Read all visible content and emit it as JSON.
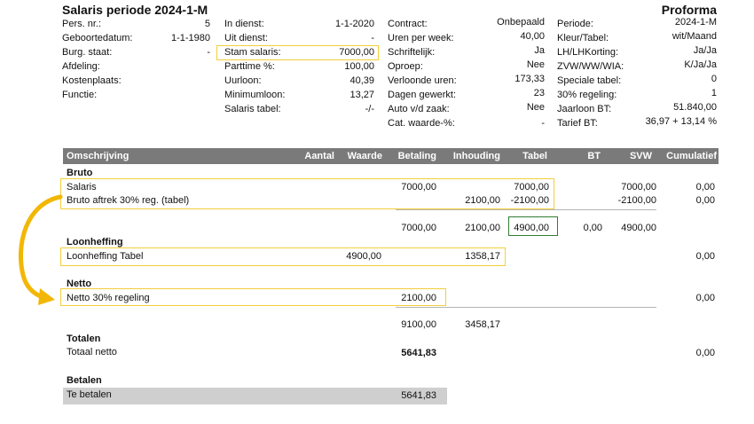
{
  "title": "Salaris periode 2024-1-M",
  "proforma": "Proforma",
  "info": {
    "col1": [
      {
        "label": "Pers. nr.:",
        "value": "5"
      },
      {
        "label": "Geboortedatum:",
        "value": "1-1-1980"
      },
      {
        "label": "Burg. staat:",
        "value": "-"
      },
      {
        "label": "Afdeling:",
        "value": ""
      },
      {
        "label": "Kostenplaats:",
        "value": ""
      },
      {
        "label": "Functie:",
        "value": ""
      }
    ],
    "col2": [
      {
        "label": "In dienst:",
        "value": "1-1-2020"
      },
      {
        "label": "Uit dienst:",
        "value": "-"
      },
      {
        "label": "Stam salaris:",
        "value": "7000,00"
      },
      {
        "label": "Parttime %:",
        "value": "100,00"
      },
      {
        "label": "Uurloon:",
        "value": "40,39"
      },
      {
        "label": "Minimumloon:",
        "value": "13,27"
      },
      {
        "label": "Salaris tabel:",
        "value": "-/-"
      }
    ],
    "col3": [
      {
        "label": "Contract:",
        "value": "Onbepaald"
      },
      {
        "label": "Uren per week:",
        "value": "40,00"
      },
      {
        "label": "Schriftelijk:",
        "value": "Ja"
      },
      {
        "label": "Oproep:",
        "value": "Nee"
      },
      {
        "label": "Verloonde uren:",
        "value": "173,33"
      },
      {
        "label": "Dagen gewerkt:",
        "value": "23"
      },
      {
        "label": "Auto v/d zaak:",
        "value": "Nee"
      },
      {
        "label": "Cat. waarde-%:",
        "value": "-"
      }
    ],
    "col4": [
      {
        "label": "Periode:",
        "value": "2024-1-M"
      },
      {
        "label": "Kleur/Tabel:",
        "value": "wit/Maand"
      },
      {
        "label": "LH/LHKorting:",
        "value": "Ja/Ja"
      },
      {
        "label": "ZVW/WW/WIA:",
        "value": "K/Ja/Ja"
      },
      {
        "label": "Speciale tabel:",
        "value": "0"
      },
      {
        "label": "30% regeling:",
        "value": "1"
      },
      {
        "label": "Jaarloon BT:",
        "value": "51.840,00"
      },
      {
        "label": "Tarief BT:",
        "value": "36,97 + 13,14 %"
      }
    ]
  },
  "table": {
    "headers": {
      "omschrijving": "Omschrijving",
      "aantal": "Aantal",
      "waarde": "Waarde",
      "betaling": "Betaling",
      "inhouding": "Inhouding",
      "tabel": "Tabel",
      "bt": "BT",
      "svw": "SVW",
      "cumulatief": "Cumulatief"
    },
    "bruto": {
      "heading": "Bruto",
      "row1": {
        "label": "Salaris",
        "betaling": "7000,00",
        "tabel": "7000,00",
        "svw": "7000,00",
        "cumulatief": "0,00"
      },
      "row2": {
        "label": "Bruto aftrek 30% reg. (tabel)",
        "inhouding": "2100,00",
        "tabel": "-2100,00",
        "svw": "-2100,00",
        "cumulatief": "0,00"
      },
      "subtotal": {
        "betaling": "7000,00",
        "inhouding": "2100,00",
        "tabel": "4900,00",
        "bt": "0,00",
        "svw": "4900,00"
      }
    },
    "loonheffing": {
      "heading": "Loonheffing",
      "row": {
        "label": "Loonheffing Tabel",
        "waarde": "4900,00",
        "inhouding": "1358,17",
        "cumulatief": "0,00"
      }
    },
    "netto": {
      "heading": "Netto",
      "row": {
        "label": "Netto 30% regeling",
        "betaling": "2100,00",
        "cumulatief": "0,00"
      },
      "subtotal": {
        "betaling": "9100,00",
        "inhouding": "3458,17"
      }
    },
    "totalen": {
      "heading": "Totalen",
      "row": {
        "label": "Totaal netto",
        "betaling": "5641,83",
        "cumulatief": "0,00"
      }
    },
    "betalen": {
      "heading": "Betalen",
      "row": {
        "label": "Te betalen",
        "betaling": "5641,83"
      }
    }
  },
  "colors": {
    "header_bg": "#7a7a7a",
    "highlight_yellow": "#f2cf3a",
    "highlight_green": "#2e7d32",
    "arrow": "#f2b705"
  }
}
